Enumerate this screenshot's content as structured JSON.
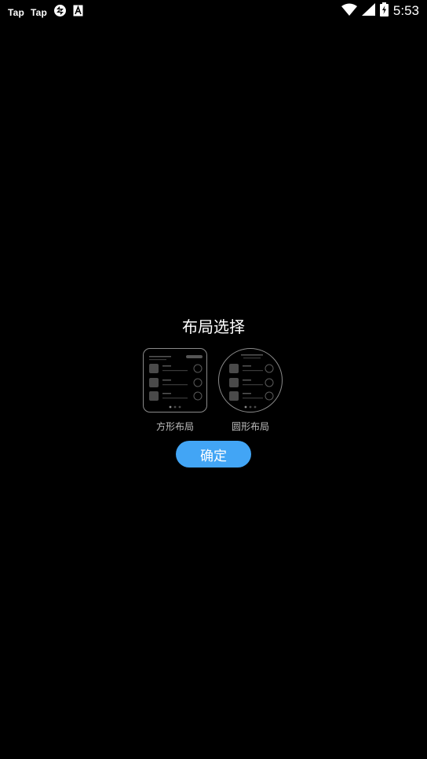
{
  "status_bar": {
    "left_items": [
      "Tap",
      "Tap"
    ],
    "icons": [
      "sync-icon",
      "font-a-icon",
      "wifi-icon",
      "signal-icon",
      "battery-charging-icon"
    ],
    "time": "5:53"
  },
  "dialog": {
    "title": "布局选择",
    "options": [
      {
        "label": "方形布局",
        "shape": "square"
      },
      {
        "label": "圆形布局",
        "shape": "round"
      }
    ],
    "confirm_label": "确定"
  },
  "colors": {
    "background": "#000000",
    "accent": "#42a5f5",
    "preview_border": "#8a8a8a",
    "label_text": "#bfbfbf"
  }
}
